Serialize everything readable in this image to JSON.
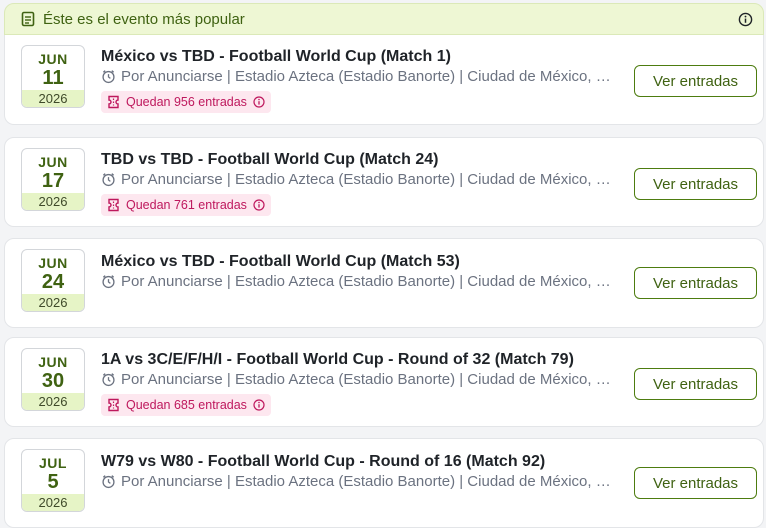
{
  "banner": {
    "text": "Éste es el evento más popular"
  },
  "events": [
    {
      "month": "JUN",
      "day": "11",
      "year": "2026",
      "title": "México vs TBD - Football World Cup (Match 1)",
      "meta": "Por Anunciarse | Estadio Azteca (Estadio Banorte) | Ciudad de México, E...",
      "badge": "Quedan 956 entradas",
      "button": "Ver entradas"
    },
    {
      "month": "JUN",
      "day": "17",
      "year": "2026",
      "title": "TBD vs TBD - Football World Cup (Match 24)",
      "meta": "Por Anunciarse | Estadio Azteca (Estadio Banorte) | Ciudad de México, E...",
      "badge": "Quedan 761 entradas",
      "button": "Ver entradas"
    },
    {
      "month": "JUN",
      "day": "24",
      "year": "2026",
      "title": "México vs TBD - Football World Cup (Match 53)",
      "meta": "Por Anunciarse | Estadio Azteca (Estadio Banorte) | Ciudad de México, E...",
      "badge": null,
      "button": "Ver entradas"
    },
    {
      "month": "JUN",
      "day": "30",
      "year": "2026",
      "title": "1A vs 3C/E/F/H/I - Football World Cup - Round of 32 (Match 79)",
      "meta": "Por Anunciarse | Estadio Azteca (Estadio Banorte) | Ciudad de México, E...",
      "badge": "Quedan 685 entradas",
      "button": "Ver entradas"
    },
    {
      "month": "JUL",
      "day": "5",
      "year": "2026",
      "title": "W79 vs W80 - Football World Cup - Round of 16 (Match 92)",
      "meta": "Por Anunciarse | Estadio Azteca (Estadio Banorte) | Ciudad de México, E...",
      "badge": null,
      "button": "Ver entradas"
    }
  ]
}
